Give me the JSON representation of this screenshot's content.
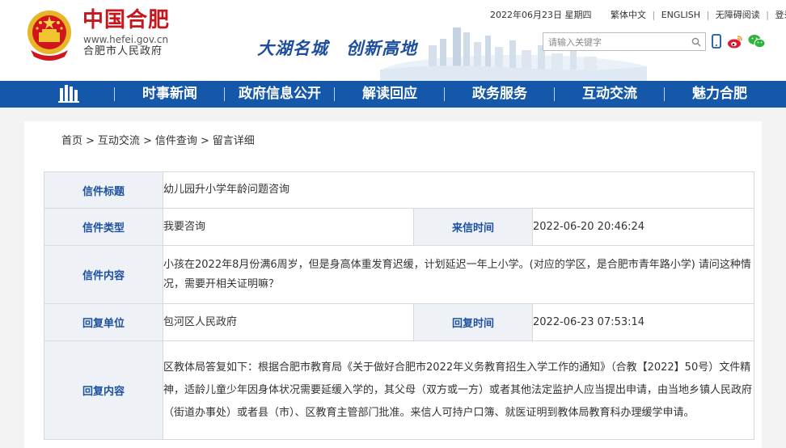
{
  "header": {
    "logo_title": "中国合肥",
    "logo_url": "www.hefei.gov.cn",
    "logo_subtitle": "合肥市人民政府",
    "slogan": "大湖名城　创新高地",
    "date": "2022年06月23日 星期四",
    "links": [
      "繁体中文",
      "ENGLISH",
      "无障碍阅读",
      "登录"
    ],
    "search_placeholder": "请输入关键字"
  },
  "nav": {
    "items": [
      "时事新闻",
      "政府信息公开",
      "解读回应",
      "政务服务",
      "互动交流",
      "魅力合肥"
    ]
  },
  "breadcrumb": [
    "首页",
    "互动交流",
    "信件查询",
    "留言详细"
  ],
  "detail": {
    "title_label": "信件标题",
    "title_value": "幼儿园升小学年龄问题咨询",
    "type_label": "信件类型",
    "type_value": "我要咨询",
    "time_label": "来信时间",
    "time_value": "2022-06-20 20:46:24",
    "content_label": "信件内容",
    "content_value": "小孩在2022年8月份满6周岁，但是身高体重发育迟缓，计划延迟一年上小学。(对应的学区，是合肥市青年路小学) 请问这种情况，需要开相关证明嘛？",
    "reply_unit_label": "回复单位",
    "reply_unit_value": "包河区人民政府",
    "reply_time_label": "回复时间",
    "reply_time_value": "2022-06-23 07:53:14",
    "reply_content_label": "回复内容",
    "reply_content_value": "区教体局答复如下：根据合肥市教育局《关于做好合肥市2022年义务教育招生入学工作的通知》（合教【2022】50号）文件精神，适龄儿童少年因身体状况需要延缓入学的，其父母（双方或一方）或者其他法定监护人应当提出申请，由当地乡镇人民政府（街道办事处）或者县（市）、区教育主管部门批准。来信人可持户口簿、就医证明到教体局教育科办理缓学申请。"
  },
  "colors": {
    "nav_blue": "#1557a8",
    "logo_red": "#c8161d",
    "label_blue": "#1d4f9e",
    "label_bg": "#eef2f7"
  }
}
